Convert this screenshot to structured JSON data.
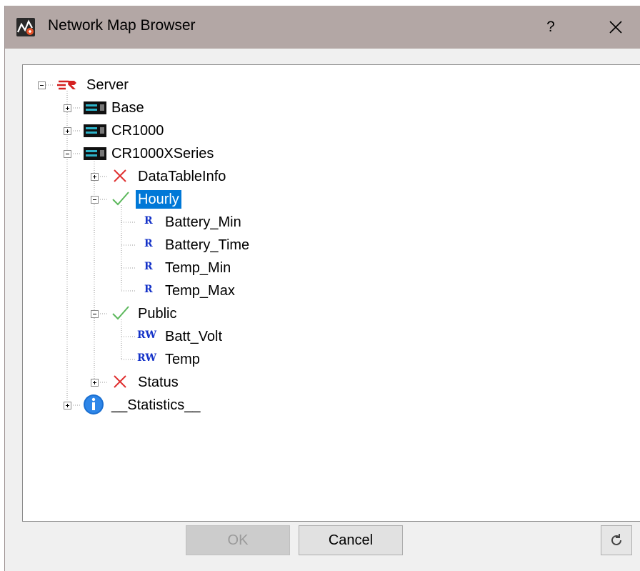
{
  "window": {
    "title": "Network Map Browser",
    "help_label": "?"
  },
  "tree": {
    "server": {
      "label": "Server",
      "icon": "campbell-logo-icon",
      "expanded": true
    },
    "nodes": [
      {
        "label": "Base",
        "icon": "datalogger-icon",
        "expanded": false
      },
      {
        "label": "CR1000",
        "icon": "datalogger-icon",
        "expanded": false
      },
      {
        "label": "CR1000XSeries",
        "icon": "datalogger-icon",
        "expanded": true
      },
      {
        "label": "DataTableInfo",
        "icon": "red-x-icon",
        "expanded": false
      },
      {
        "label": "Hourly",
        "icon": "green-check-icon",
        "expanded": true,
        "selected": true
      },
      {
        "label": "Battery_Min",
        "badge": "R"
      },
      {
        "label": "Battery_Time",
        "badge": "R"
      },
      {
        "label": "Temp_Min",
        "badge": "R"
      },
      {
        "label": "Temp_Max",
        "badge": "R"
      },
      {
        "label": "Public",
        "icon": "green-check-icon",
        "expanded": true
      },
      {
        "label": "Batt_Volt",
        "badge": "RW"
      },
      {
        "label": "Temp",
        "badge": "RW"
      },
      {
        "label": "Status",
        "icon": "red-x-icon",
        "expanded": false
      },
      {
        "label": "__Statistics__",
        "icon": "info-icon",
        "expanded": false
      }
    ]
  },
  "buttons": {
    "ok": "OK",
    "cancel": "Cancel"
  },
  "colors": {
    "titlebar": "#b3a7a5",
    "selection": "#0078d7",
    "badge_blue": "#1432c8",
    "check_green": "#5cb85c",
    "x_red": "#e03030"
  }
}
